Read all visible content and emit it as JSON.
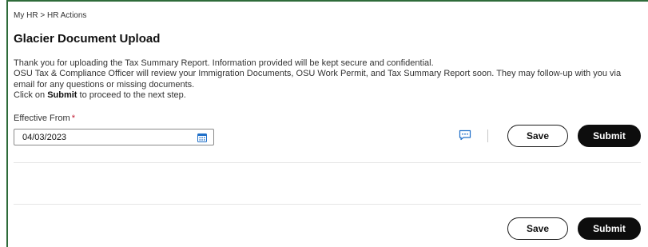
{
  "breadcrumb": {
    "root": "My HR",
    "separator": ">",
    "current": "HR Actions"
  },
  "page": {
    "title": "Glacier Document Upload",
    "description": {
      "line1": "Thank you for uploading the Tax Summary Report. Information provided will be kept secure and confidential.",
      "line2": "OSU Tax & Compliance Officer will review your Immigration Documents, OSU Work Permit, and Tax Summary Report soon. They may follow-up with you via email for any questions or missing documents.",
      "line3_prefix": "Click on ",
      "line3_bold": "Submit",
      "line3_suffix": " to proceed to the next step."
    }
  },
  "form": {
    "effective_from_label": "Effective From",
    "required_marker": "*",
    "effective_from_value": "04/03/2023",
    "calendar_icon": "calendar-icon"
  },
  "actions_top": {
    "comment_icon": "comment-icon",
    "save_label": "Save",
    "submit_label": "Submit"
  },
  "actions_bottom": {
    "save_label": "Save",
    "submit_label": "Submit"
  },
  "colors": {
    "frame": "#2e6b3a",
    "required": "#c0162e",
    "submit_bg": "#0d0d0d",
    "accent_icon": "#1f6fc8"
  }
}
